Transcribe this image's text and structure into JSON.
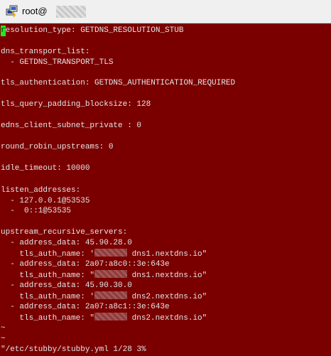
{
  "window": {
    "title": "root@",
    "app_icon": "putty-icon"
  },
  "colors": {
    "terminal_bg": "#7a0000",
    "terminal_fg": "#e4e4e4",
    "cursor": "#22e822",
    "titlebar_bg": "#f0f0f0"
  },
  "terminal": {
    "cursor_char": "r",
    "l01_rest": "esolution_type: GETDNS_RESOLUTION_STUB",
    "l02": "dns_transport_list:",
    "l03": "  - GETDNS_TRANSPORT_TLS",
    "l04": "tls_authentication: GETDNS_AUTHENTICATION_REQUIRED",
    "l05": "tls_query_padding_blocksize: 128",
    "l06": "edns_client_subnet_private : 0",
    "l07": "round_robin_upstreams: 0",
    "l08": "idle_timeout: 10000",
    "l09": "listen_addresses:",
    "l10": "  - 127.0.0.1@53535",
    "l11": "  -  0::1@53535",
    "l12": "upstream_recursive_servers:",
    "l13": "  - address_data: 45.90.28.0",
    "l14a": "    tls_auth_name: '",
    "l14b": " dns1.nextdns.io\"",
    "l15": "  - address_data: 2a07:a8c0::3e:643e",
    "l16a": "    tls_auth_name: \"",
    "l16b": " dns1.nextdns.io\"",
    "l17": "  - address_data: 45.90.30.0",
    "l18a": "    tls_auth_name: '",
    "l18b": " dns2.nextdns.io\"",
    "l19": "  - address_data: 2a07:a8c1::3e:643e",
    "l20a": "    tls_auth_name: \"",
    "l20b": " dns2.nextdns.io\"",
    "tilde1": "~",
    "tilde2": "~",
    "status_line": "\"/etc/stubby/stubby.yml 1/28 3%"
  }
}
